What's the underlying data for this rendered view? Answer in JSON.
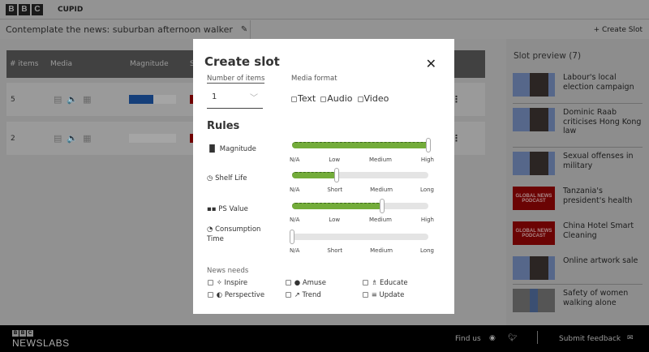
{
  "header": {
    "brand": [
      "B",
      "B",
      "C"
    ],
    "app_name": "CUPID"
  },
  "titlebar": {
    "title": "Contemplate the news: suburban afternoon walker",
    "edit_icon": "pencil-icon",
    "create_slot": "+ Create Slot"
  },
  "table": {
    "columns": [
      "# items",
      "Media",
      "Magnitude",
      "S"
    ],
    "rows": [
      {
        "items": "5",
        "media": [
          "text",
          "audio",
          "video"
        ],
        "magnitude": 0.6
      },
      {
        "items": "2",
        "media": [
          "text",
          "audio",
          "video"
        ],
        "magnitude": 0
      }
    ]
  },
  "slot_preview": {
    "title": "Slot preview (7)",
    "items": [
      {
        "title": "Labour's local election campaign",
        "thumb": "big-ben"
      },
      {
        "title": "Dominic Raab criticises Hong Kong law",
        "thumb": "big-ben"
      },
      {
        "title": "Sexual offenses in military",
        "thumb": "big-ben"
      },
      {
        "title": "Tanzania's president's health",
        "thumb": "global-news-podcast"
      },
      {
        "title": "China Hotel Smart Cleaning",
        "thumb": "global-news-podcast"
      },
      {
        "title": "Online artwork sale",
        "thumb": "big-ben"
      },
      {
        "title": "Safety of women walking alone",
        "thumb": "woman"
      }
    ],
    "podcast_label": "GLOBAL NEWS PODCAST"
  },
  "modal": {
    "title": "Create slot",
    "number_label": "Number of items",
    "number_value": "1",
    "media_label": "Media format",
    "media_options": [
      "Text",
      "Audio",
      "Video"
    ],
    "rules_title": "Rules",
    "rules": [
      {
        "label": "Magnitude",
        "icon": "bar-chart-icon",
        "ticks": [
          "N/A",
          "Low",
          "Medium",
          "High"
        ],
        "value": "High",
        "level": 1.0
      },
      {
        "label": "Shelf Life",
        "icon": "clock-icon",
        "ticks": [
          "N/A",
          "Short",
          "Medium",
          "Long"
        ],
        "value": "Short",
        "level": 0.33
      },
      {
        "label": "PS Value",
        "icon": "grid-icon",
        "ticks": [
          "N/A",
          "Low",
          "Medium",
          "High"
        ],
        "value": "Medium",
        "level": 0.66
      },
      {
        "label": "Consumption Time",
        "icon": "timer-icon",
        "ticks": [
          "N/A",
          "Short",
          "Medium",
          "Long"
        ],
        "value": "N/A",
        "level": 0
      }
    ],
    "news_needs_label": "News needs",
    "news_needs": [
      "Inspire",
      "Amuse",
      "Educate",
      "Perspective",
      "Trend",
      "Update"
    ]
  },
  "footer": {
    "brand": "NEWSLABS",
    "find_us": "Find us",
    "feedback": "Submit feedback"
  },
  "colors": {
    "accent_green": "#73ac3a",
    "magnitude_blue": "#153f7a",
    "footer_bg": "#000000"
  }
}
